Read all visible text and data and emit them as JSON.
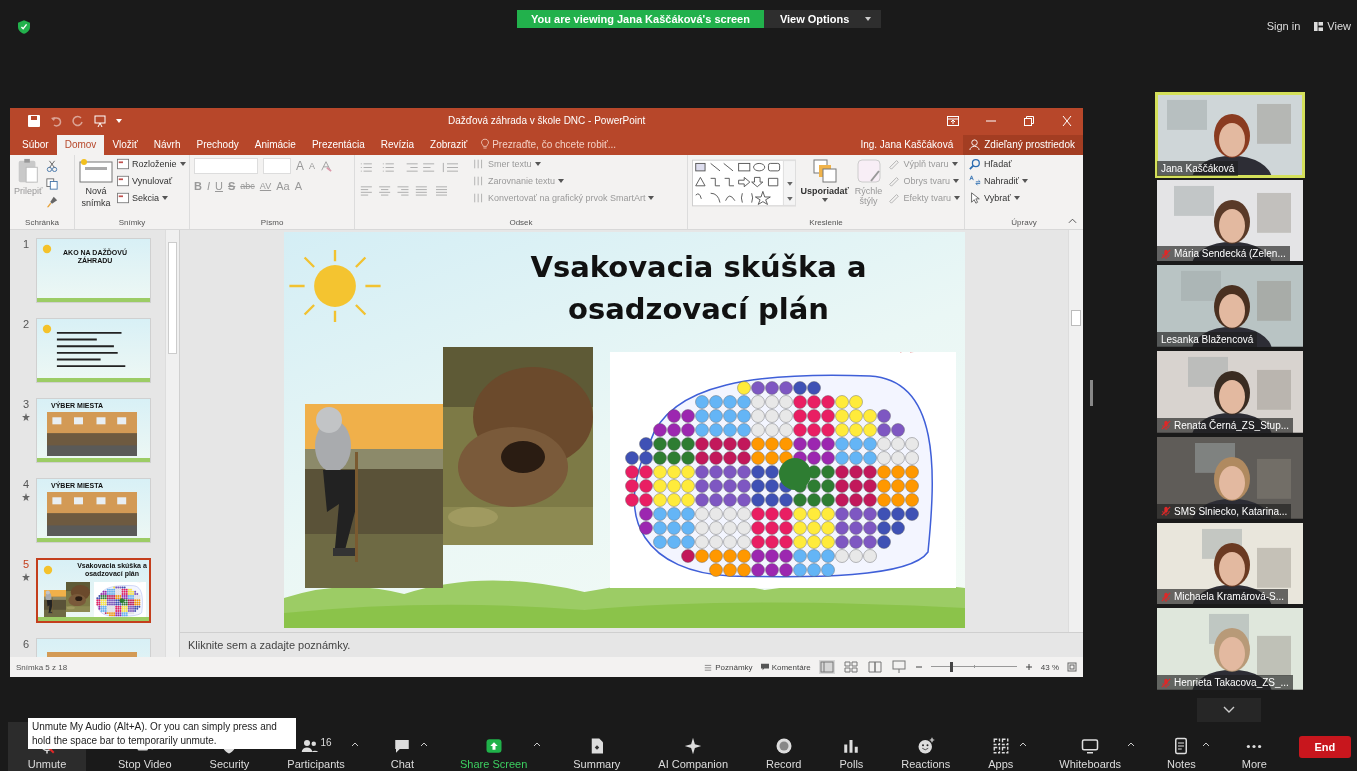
{
  "top_bar": {
    "banner": "You are viewing Jana Kaščáková's screen",
    "view_options": "View Options",
    "sign_in": "Sign in",
    "view": "View"
  },
  "powerpoint": {
    "title": "Dažďová záhrada v škole DNC - PowerPoint",
    "tabs": [
      {
        "label": "Súbor",
        "selected": false
      },
      {
        "label": "Domov",
        "selected": true
      },
      {
        "label": "Vložiť",
        "selected": false
      },
      {
        "label": "Návrh",
        "selected": false
      },
      {
        "label": "Prechody",
        "selected": false
      },
      {
        "label": "Animácie",
        "selected": false
      },
      {
        "label": "Prezentácia",
        "selected": false
      },
      {
        "label": "Revízia",
        "selected": false
      },
      {
        "label": "Zobraziť",
        "selected": false
      }
    ],
    "tell_me": "Prezraďte, čo chcete robiť...",
    "user": "Ing. Jana Kaščáková",
    "share": "Zdieľaný prostriedok",
    "ribbon": {
      "clipboard": {
        "label": "Schránka",
        "paste": {
          "label": "Prilepiť",
          "disabled": true
        }
      },
      "slides": {
        "label": "Snímky",
        "new_slide": "Nová snímka",
        "commands": [
          {
            "label": "Rozloženie",
            "menu": true
          },
          {
            "label": "Vynulovať",
            "menu": false
          },
          {
            "label": "Sekcia",
            "menu": true
          }
        ]
      },
      "font": {
        "label": "Písmo",
        "disabled": true,
        "size_buttons": [
          "A",
          "A"
        ],
        "buttons": [
          "B",
          "I",
          "U",
          "S",
          "abc",
          "AV",
          "Aa",
          "A"
        ]
      },
      "paragraph": {
        "label": "Odsek",
        "commands": [
          {
            "label": "Smer textu",
            "disabled": true
          },
          {
            "label": "Zarovnanie textu",
            "disabled": true
          },
          {
            "label": "Konvertovať na grafický prvok SmartArt",
            "disabled": true
          }
        ]
      },
      "drawing": {
        "label": "Kreslenie",
        "arrange": "Usporiadať",
        "quick_styles": {
          "label": "Rýchle štýly",
          "disabled": true
        },
        "commands": [
          {
            "label": "Výplň tvaru",
            "disabled": true
          },
          {
            "label": "Obrys tvaru",
            "disabled": true
          },
          {
            "label": "Efekty tvaru",
            "disabled": true
          }
        ]
      },
      "editing": {
        "label": "Úpravy",
        "commands": [
          {
            "label": "Hľadať",
            "menu": false
          },
          {
            "label": "Nahradiť",
            "menu": true
          },
          {
            "label": "Vybrať",
            "menu": true
          }
        ]
      }
    },
    "slides": [
      {
        "number": "1",
        "kind": "title",
        "title": "AKO NA DAŽĎOVÚ ZÁHRADU",
        "animated": false,
        "selected": false
      },
      {
        "number": "2",
        "kind": "bullets",
        "animated": false,
        "selected": false
      },
      {
        "number": "3",
        "title": "VÝBER MIESTA",
        "animated": true,
        "selected": false
      },
      {
        "number": "4",
        "title": "VÝBER MIESTA",
        "animated": true,
        "selected": false
      },
      {
        "number": "5",
        "kind": "plan",
        "title": "Vsakovacia skúška a osadzovací plán",
        "animated": true,
        "selected": true
      },
      {
        "number": "6",
        "animated": false,
        "selected": false
      }
    ],
    "slide": {
      "title": "Vsakovacia skúška a osadzovací plán"
    },
    "notes": {
      "placeholder": "Kliknite sem a zadajte poznámky."
    },
    "status": {
      "position": "Snímka 5 z 18",
      "notes": "Poznámky",
      "comments": "Komentáre",
      "zoom": "43 %",
      "zoom_slider": {
        "level": 0.22
      }
    }
  },
  "participants": [
    {
      "name": "Jana Kaščáková",
      "muted": false,
      "speaking": true
    },
    {
      "name": "Mária Sendecká (Zelen...",
      "muted": true,
      "speaking": false
    },
    {
      "name": "Lesanka Blažencová",
      "muted": false,
      "speaking": false
    },
    {
      "name": "Renata Černá_ZS_Stup...",
      "muted": true,
      "speaking": false
    },
    {
      "name": "SMS Slniecko, Katarina...",
      "muted": true,
      "speaking": false
    },
    {
      "name": "Michaela Kramárová-S...",
      "muted": true,
      "speaking": false
    },
    {
      "name": "Henrieta Takacova_ZS_...",
      "muted": true,
      "speaking": false
    }
  ],
  "tooltip": "Unmute My Audio (Alt+A). Or you can simply press and hold the space bar to temporarily unmute.",
  "toolbar": [
    {
      "label": "Unmute",
      "menu": false,
      "highlighted": false
    },
    {
      "label": "Stop Video",
      "menu": false,
      "highlighted": false
    },
    {
      "label": "Security",
      "menu": false,
      "highlighted": false
    },
    {
      "label": "Participants",
      "count": "16",
      "menu": true,
      "highlighted": false
    },
    {
      "label": "Chat",
      "menu": true,
      "highlighted": false
    },
    {
      "label": "Share Screen",
      "menu": true,
      "highlighted": true
    },
    {
      "label": "Summary",
      "menu": false,
      "highlighted": false
    },
    {
      "label": "AI Companion",
      "menu": false,
      "highlighted": false
    },
    {
      "label": "Record",
      "menu": false,
      "highlighted": false
    },
    {
      "label": "Polls",
      "menu": false,
      "highlighted": false
    },
    {
      "label": "Reactions",
      "menu": false,
      "highlighted": false
    },
    {
      "label": "Apps",
      "menu": true,
      "highlighted": false
    },
    {
      "label": "Whiteboards",
      "menu": true,
      "highlighted": false
    },
    {
      "label": "Notes",
      "menu": true,
      "highlighted": false
    },
    {
      "label": "More",
      "menu": false,
      "highlighted": false
    }
  ],
  "end": "End"
}
